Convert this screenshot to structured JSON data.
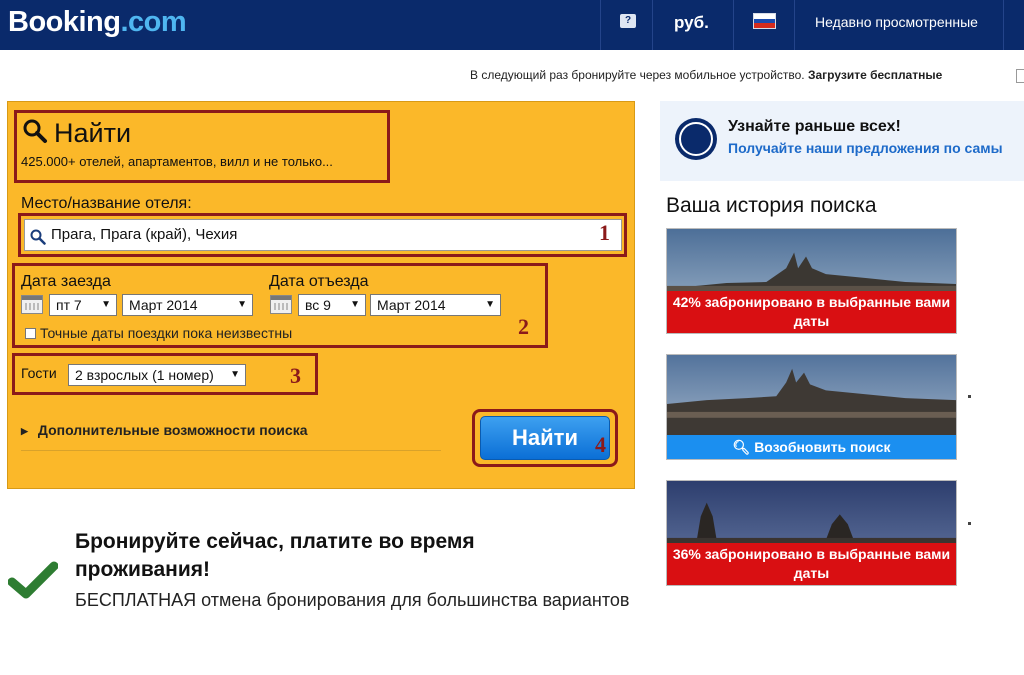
{
  "header": {
    "logo_main": "Booking",
    "logo_suffix": ".com",
    "help_icon": "question-icon",
    "currency": "руб.",
    "language_flag": "russia-flag-icon",
    "recently_viewed": "Недавно просмотренные"
  },
  "mobile_notice": {
    "text": "В следующий раз бронируйте через мобильное устройство.",
    "link": "Загрузите бесплатные"
  },
  "search": {
    "title": "Найти",
    "subtitle": "425.000+ отелей, апартаментов, вилл и не только...",
    "destination_label": "Место/название отеля:",
    "destination_value": "Прага, Прага (край), Чехия",
    "checkin_label": "Дата заезда",
    "checkin_day": "пт 7",
    "checkin_month": "Март 2014",
    "checkout_label": "Дата отъезда",
    "checkout_day": "вс 9",
    "checkout_month": "Март 2014",
    "flexible_dates_label": "Точные даты поездки пока неизвестны",
    "flexible_dates_checked": false,
    "guests_label": "Гости",
    "guests_value": "2 взрослых (1 номер)",
    "more_options": "Дополнительные возможности поиска",
    "submit": "Найти"
  },
  "annotations": [
    "1",
    "2",
    "3",
    "4"
  ],
  "promo": {
    "title": "Бронируйте сейчас, платите во время проживания!",
    "subtitle": "БЕСПЛАТНАЯ отмена бронирования для большинства вариантов"
  },
  "notify": {
    "title": "Узнайте раньше всех!",
    "subtitle": "Получайте наши предложения по самы"
  },
  "history": {
    "title": "Ваша история поиска",
    "cards": [
      {
        "label": "42% забронировано в выбранные вами даты"
      },
      {
        "label": "Возобновить поиск"
      },
      {
        "label": "36% забронировано в выбранные вами даты"
      }
    ]
  },
  "colors": {
    "header_bg": "#0a2a6b",
    "panel_bg": "#fbb829",
    "annotation": "#8b1a1a",
    "button": "#0b6fd6",
    "label_red": "#d90f12",
    "label_blue": "#1b8ff0",
    "link": "#1d6ac9",
    "check_green": "#2e7d32"
  }
}
